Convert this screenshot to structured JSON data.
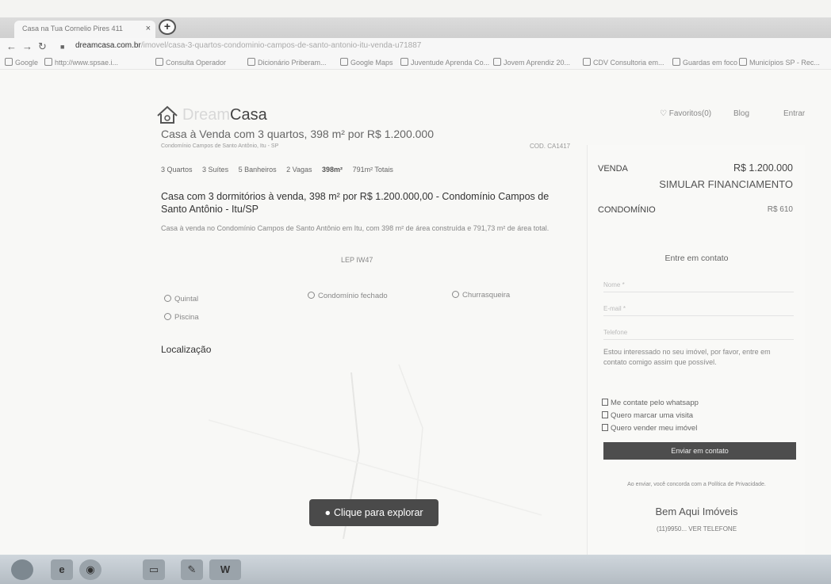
{
  "browser": {
    "tab_title": "Casa na Tua Cornelio Pires 411",
    "tab_close": "×",
    "newtab": "+",
    "url_host": "dreamcasa.com.br",
    "url_path": "/imovel/casa-3-quartos-condominio-campos-de-santo-antonio-itu-venda-u71887",
    "bookmarks": [
      {
        "label": "Google",
        "icon": "google-icon"
      },
      {
        "label": "http://www.spsae.i...",
        "icon": "globe-icon"
      },
      {
        "label": "Consulta Operador",
        "icon": "page-icon"
      },
      {
        "label": "Dicionário Priberam...",
        "icon": "book-icon"
      },
      {
        "label": "Google Maps",
        "icon": "map-pin-icon"
      },
      {
        "label": "Juventude Aprenda Co...",
        "icon": "link-icon"
      },
      {
        "label": "Jovem Aprendiz 20...",
        "icon": "globe-icon"
      },
      {
        "label": "CDV Consultoria em...",
        "icon": "globe-icon"
      },
      {
        "label": "Guardas em foco",
        "icon": "page-icon"
      },
      {
        "label": "Municípios SP - Rec...",
        "icon": "globe-icon"
      }
    ]
  },
  "site": {
    "logo_prefix": "Dream",
    "logo_name": "Casa",
    "nav": [
      "♡ Favoritos(0)",
      "Blog",
      "Entrar"
    ]
  },
  "listing": {
    "title": "Casa à Venda com 3 quartos, 398 m² por R$ 1.200.000",
    "subtitle": "Condomínio Campos de Santo Antônio, Itu - SP",
    "code": "COD. CA1417",
    "features": {
      "quartos": "3 Quartos",
      "suites": "3 Suítes",
      "banheiros": "5 Banheiros",
      "vagas": "2 Vagas",
      "area_built": "398m²",
      "area_total": "791m² Totais"
    },
    "heading": "Casa com 3 dormitórios à venda, 398 m² por R$ 1.200.000,00 - Condomínio Campos de Santo Antônio - Itu/SP",
    "description": "Casa à venda no Condomínio Campos de Santo Antônio em Itu, com 398 m² de área construída e 791,73 m² de área total.",
    "ref": "LEP IW47",
    "amenities": [
      "Quintal",
      "Condomínio fechado",
      "Churrasqueira",
      "Piscina"
    ],
    "location_title": "Localização",
    "explore_label": "Clique para explorar"
  },
  "sidebar": {
    "venda_label": "VENDA",
    "venda_value": "R$ 1.200.000",
    "simular": "SIMULAR FINANCIAMENTO",
    "condo_label": "CONDOMÍNIO",
    "condo_value": "R$ 610",
    "contact_title": "Entre em contato",
    "name_placeholder": "Nome *",
    "email_placeholder": "E-mail *",
    "phone_placeholder": "Telefone",
    "message": "Estou interessado no seu imóvel, por favor, entre em contato comigo assim que possível.",
    "checkboxes": [
      "Me contate pelo whatsapp",
      "Quero marcar uma visita",
      "Quero vender meu imóvel"
    ],
    "send_label": "Enviar em contato",
    "privacy": "Ao enviar, você concorda com a Política de Privacidade.",
    "agency": "Bem Aqui Imóveis",
    "phone": "(11)9950... VER TELEFONE"
  },
  "taskbar": {
    "items": [
      "start-orb-icon",
      "ie-icon",
      "chrome-icon",
      "folder-icon",
      "paint-icon",
      "word-icon"
    ],
    "word_label": "W"
  }
}
